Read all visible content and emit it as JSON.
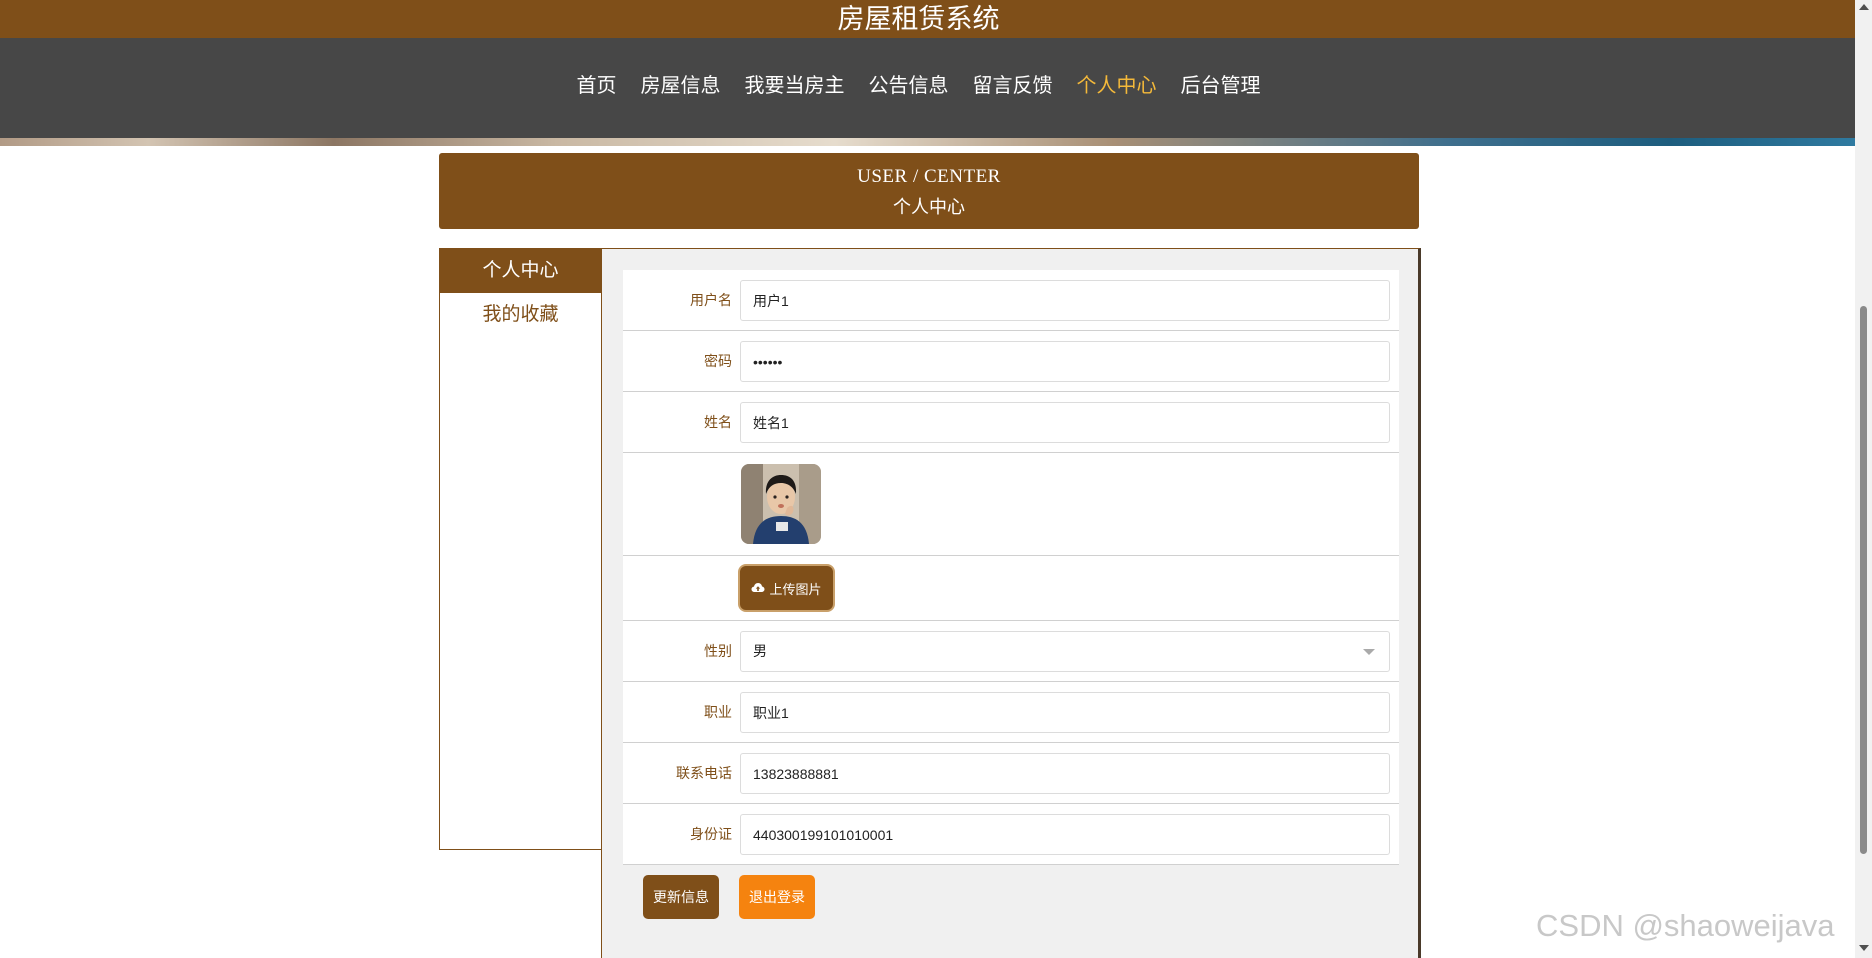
{
  "site": {
    "title": "房屋租赁系统"
  },
  "nav": {
    "items": [
      {
        "label": "首页"
      },
      {
        "label": "房屋信息"
      },
      {
        "label": "我要当房主"
      },
      {
        "label": "公告信息"
      },
      {
        "label": "留言反馈"
      },
      {
        "label": "个人中心",
        "active": true
      },
      {
        "label": "后台管理"
      }
    ]
  },
  "section": {
    "title_en": "USER / CENTER",
    "title_cn": "个人中心"
  },
  "sidebar": {
    "items": [
      {
        "label": "个人中心",
        "active": true
      },
      {
        "label": "我的收藏"
      }
    ]
  },
  "form": {
    "username": {
      "label": "用户名",
      "value": "用户1"
    },
    "password": {
      "label": "密码",
      "value": "••••••"
    },
    "name": {
      "label": "姓名",
      "value": "姓名1"
    },
    "avatar": {
      "icon": "user-photo"
    },
    "upload": {
      "label": "上传图片",
      "icon": "cloud-upload-icon"
    },
    "gender": {
      "label": "性别",
      "value": "男"
    },
    "occupation": {
      "label": "职业",
      "value": "职业1"
    },
    "phone": {
      "label": "联系电话",
      "value": "13823888881"
    },
    "id_card": {
      "label": "身份证",
      "value": "440300199101010001"
    }
  },
  "actions": {
    "update_label": "更新信息",
    "logout_label": "退出登录"
  },
  "watermark": "CSDN @shaoweijava",
  "colors": {
    "brand": "#7f4f19",
    "nav_bg": "#474747",
    "nav_active": "#f4b93a",
    "logout": "#f5830f"
  }
}
